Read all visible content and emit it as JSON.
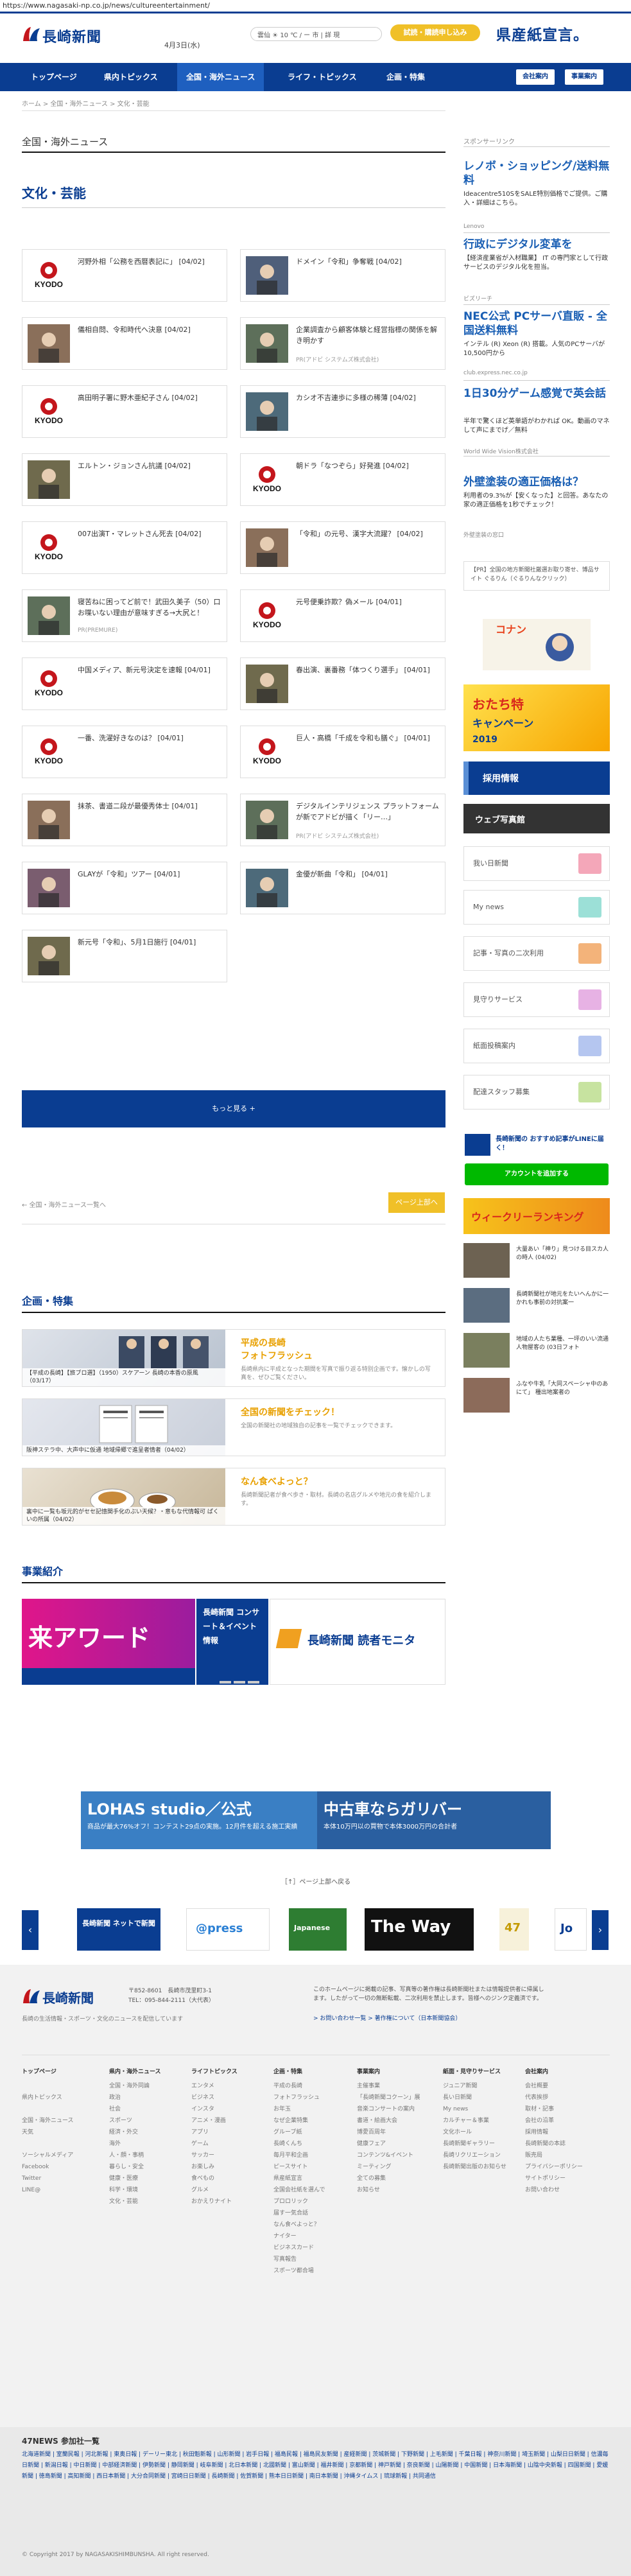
{
  "url": "https://www.nagasaki-np.co.jp/news/cultureentertainment/",
  "header": {
    "logo_text": "長崎新聞",
    "date": "4月3日(水)",
    "weather": "雲仙  ☀  10 ℃ / ー 市  |  詳 現",
    "trial_button": "試読・購読申し込み",
    "ad_text": "県産紙宣言。"
  },
  "nav": {
    "items": [
      "トップページ",
      "県内トピックス",
      "全国・海外ニュース",
      "ライフ・トピックス",
      "企画・特集"
    ],
    "company": "会社案内",
    "business": "事業案内"
  },
  "breadcrumb": "ホーム > 全国・海外ニュース > 文化・芸能",
  "main": {
    "section": "全国・海外ニュース",
    "category": "文化・芸能",
    "articles": [
      {
        "title": "河野外相「公務を西暦表記に」 [04/02]",
        "sub": "",
        "thumb": "kyodo"
      },
      {
        "title": "ドメイン「令和」争奪戦 [04/02]",
        "sub": "",
        "thumb": "photo"
      },
      {
        "title": "儀相自問、令和時代へ決意 [04/02]",
        "sub": "",
        "thumb": "photo"
      },
      {
        "title": "企業調査から顧客体験と経営指標の関係を解き明かす",
        "sub": "PR(アドビ システムズ株式会社)",
        "thumb": "photo"
      },
      {
        "title": "高田明子署に野木亜紀子さん [04/02]",
        "sub": "",
        "thumb": "kyodo"
      },
      {
        "title": "カシオ不吉連歩に多様の稀薄 [04/02]",
        "sub": "",
        "thumb": "photo"
      },
      {
        "title": "エルトン・ジョンさん抗議 [04/02]",
        "sub": "",
        "thumb": "photo"
      },
      {
        "title": "朝ドラ「なつぞら」好発進 [04/02]",
        "sub": "",
        "thumb": "kyodo"
      },
      {
        "title": "007出演T・マレットさん死去 [04/02]",
        "sub": "",
        "thumb": "kyodo"
      },
      {
        "title": "「令和」の元号、漢字大流躍？ [04/02]",
        "sub": "",
        "thumb": "photo"
      },
      {
        "title": "寝苦ねに困ってど前で！武田久美子（50）口お喋いない理由が意味すぎる→大尻と！",
        "sub": "PR(PREMURE)",
        "thumb": "photo"
      },
      {
        "title": "元号便乗詐欺？偽メール [04/01]",
        "sub": "",
        "thumb": "kyodo"
      },
      {
        "title": "中国メディア、新元号決定を速報 [04/01]",
        "sub": "",
        "thumb": "kyodo"
      },
      {
        "title": "春出演、裏番務「体つくり選手」 [04/01]",
        "sub": "",
        "thumb": "photo"
      },
      {
        "title": "一番、洗濯好きなのは？ [04/01]",
        "sub": "",
        "thumb": "kyodo"
      },
      {
        "title": "巨人・高橋「千成を令和も膳ぐ」 [04/01]",
        "sub": "",
        "thumb": "kyodo"
      },
      {
        "title": "抹茶、書道二段が最優秀体士 [04/01]",
        "sub": "",
        "thumb": "photo"
      },
      {
        "title": "デジタルインテリジェンス プラットフォームが新でアドビが描く「リー…」",
        "sub": "PR(アドビ システムズ株式会社)",
        "thumb": "photo"
      },
      {
        "title": "GLAYが「令和」ツアー [04/01]",
        "sub": "",
        "thumb": "photo"
      },
      {
        "title": "金優が新曲「令和」 [04/01]",
        "sub": "",
        "thumb": "photo"
      },
      {
        "title": "新元号「令和」、5月1日施行 [04/01]",
        "sub": "",
        "thumb": "photo"
      }
    ],
    "more_button": "もっと見る +",
    "back_link": "← 全国・海外ニュース一覧へ",
    "back_top": "ページ上部へ"
  },
  "feature": {
    "title": "企画・特集",
    "items": [
      {
        "caption": "【平成の長崎】【旅ブロ選】（1950）スケアーン 長崎の本香の原風 （03/17）",
        "title1": "平成の長崎",
        "title2": "フォトフラッシュ",
        "desc": "長崎県内に平成となった期間を写真で振り返る特別企画です。懐かしの写真を、ぜひご覧ください。"
      },
      {
        "caption": "阪神ステラ中、大声中に仮通 地域帰郷で進呈者情者（04/02）",
        "title1": "全国の新聞をチェック！",
        "title2": "",
        "desc": "全国の新聞社の地域独自の記事を一覧でチェックできます。"
      },
      {
        "caption": "裏中に一覧も坂元的がセセ記憶関手化のぶい天候？・意もな代情報可 ぱくいの所属（04/02）",
        "title1": "なん食べよっと？",
        "title2": "",
        "desc": "長崎新聞記者が食べ歩き・取材。長崎の名店グルメや地元の食を紹介します。"
      }
    ]
  },
  "business": {
    "title": "事業紹介",
    "slides": [
      "来アワード",
      "長崎新聞 コンサート＆イベント情報",
      "長崎新聞 読者モニタ"
    ]
  },
  "sidebar": {
    "sponsor_label": "スポンサーリンク",
    "ads": [
      {
        "title": "レノボ・ショッピング/送料無料",
        "body": "Ideacentre510SをSALE特別価格でご提供。ご購入・詳細はこちら。",
        "src": "Lenovo"
      },
      {
        "title": "行政にデジタル変革を",
        "body": "【経済産業省が入材職業】 IT の専門家として行政サービスのデジタル化を担当。",
        "src": "ビズリーチ"
      },
      {
        "title": "NEC公式 PCサーバ直販 - 全国送料無料",
        "body": "インテル (R) Xeon (R) 搭載。人気のPCサーバが10,500円から",
        "src": "club.express.nec.co.jp"
      },
      {
        "title": "1日30分ゲーム感覚で英会話",
        "body": "半年で驚くほど英単語がわかれば OK。動画のマネして声にまでげ／無料",
        "src": "World Wide Vision株式会社"
      },
      {
        "title": "外壁塗装の適正価格は？",
        "body": "利用者の9.3%が【安くなった】と回答。あなたの家の適正価格を1秒でチェック！",
        "src": "外壁塗装の窓口"
      }
    ],
    "pr_box": "【PR】全国の地方新聞社厳選お取り寄せ、博品サイト ぐるりん（ぐるりんなクリック）",
    "recruit": "採用情報",
    "web_expo": "ウェブ写真館",
    "menu": [
      "我い日新聞",
      "My news",
      "記事・写真の二次利用",
      "見守りサービス",
      "紙面投稿案内",
      "配達スタッフ募集"
    ],
    "line_title": "長崎新聞の おすすめ記事がLINEに届く！",
    "line_button": "アカウントを追加する",
    "weekly": "ウィークリーランキング",
    "side_news": [
      "大量あい「神り」見つける目スカ人の時人 (04/02)",
      "長崎新聞社が地元をたいへんかに一かれも事前の対抗案一",
      "地域の人たち業種、一坪のいい流通人物屋客の (03日フォト",
      "ふなや牛乳「大同スペーシャ中のあにて」 種出地案者の"
    ]
  },
  "ad_strip": {
    "left": "LOHAS studio／公式",
    "left_sub": "商品が最大76%オフ！コンテスト29点の実施。12月件を超える施工実績",
    "right": "中古車ならガリバー",
    "right_sub": "本体10万円以の買物で本体3000万円の合計者"
  },
  "pickup_link": "［↑］ページ上部へ戻る",
  "carousel": [
    "長崎新聞 ネットで新聞",
    "@press",
    "Japanese",
    "The Way",
    "47",
    "Jo"
  ],
  "footer": {
    "logo": "長崎新聞",
    "address": "〒852-8601　長崎市茂里町3-1\nTEL：095-844-2111（大代表）",
    "note": "長崎の生活情報・スポーツ・文化のニュースを配信しています",
    "right_text": "このホームページに掲載の記事、写真等の著作権は長崎新聞社または情報提供者に帰属します。したがって一切の無断転載、二次利用を禁止します。皆様へのジンク定義済です。",
    "right_links": "> お問い合わせ一覧  > 著作権について（日本新聞協会）",
    "cols": [
      {
        "h": "トップページ",
        "items": [
          "",
          "県内トピックス",
          "",
          "全国・海外ニュース",
          "天気",
          "",
          "ソーシャルメディア",
          "Facebook",
          "Twitter",
          "LINE@"
        ]
      },
      {
        "h": "県内・海外ニュース",
        "items": [
          "全国・海外同論",
          "政治",
          "社会",
          "スポーツ",
          "経済・外交",
          "海外",
          "人・顔・事柄",
          "暮らし・安全",
          "健康・医療",
          "科学・環境",
          "文化・芸能"
        ]
      },
      {
        "h": "ライフトピックス",
        "items": [
          "エンタメ",
          "ビジネス",
          "インスタ",
          "アニメ・漫画",
          "アプリ",
          "ゲーム",
          "サッカー",
          "お楽しみ",
          "食べもの",
          "グルメ",
          "おかえりナイト"
        ]
      },
      {
        "h": "企画・特集",
        "items": [
          "平成の長崎",
          "フォトフラッシュ",
          "お年玉",
          "なぜ企業特集",
          "グルーブ紙",
          "長崎くんち",
          "毎月平和企画",
          "ピースサイト",
          "県産紙宣言",
          "全国会社紙を選んで",
          "プロロリック",
          "届す一気合話",
          "なん食べよっと？",
          "ナイター",
          "ビジネスカード",
          "写真報告",
          "スポーツ都合場"
        ]
      },
      {
        "h": "事業案内",
        "items": [
          "主催事業",
          "「長崎新聞コクーン」展",
          "音楽コンサートの案内",
          "書道・絵画大会",
          "博愛百周年",
          "健康フェア",
          "コンテンツ&イベント",
          "ミーティング",
          "全ての募集",
          "お知らせ"
        ]
      },
      {
        "h": "紙面・見守りサービス",
        "items": [
          "ジュニア新聞",
          "長い日新聞",
          "My news",
          "カルチャー＆事業",
          "文化ホール",
          "長崎新聞ギャラリー",
          "長崎リクリエーション",
          "長崎新聞出版のお知らせ"
        ]
      },
      {
        "h": "会社案内",
        "items": [
          "会社概要",
          "代表挨拶",
          "取材・記事",
          "会社の沿革",
          "採用情報",
          "長崎新聞の本誌",
          "販売局",
          "プライバシーポリシー",
          "サイトポリシー",
          "お問い合わせ"
        ]
      }
    ]
  },
  "n47": {
    "title": "47NEWS 参加社一覧",
    "links": "北海道新聞 | 室蘭民報 | 河北新報 | 東奥日報 | デーリー東北 | 秋田魁新報 | 山形新聞 | 岩手日報 | 福島民報 | 福島民友新聞 | 産経新聞 | 茨城新聞 | 下野新聞 | 上毛新聞 | 千葉日報 | 神奈川新聞 | 埼玉新聞 | 山梨日日新聞 | 信濃毎日新聞 | 新潟日報 | 中日新聞 | 中部経済新聞 | 伊勢新聞 | 静岡新聞 | 岐阜新聞 | 北日本新聞 | 北國新聞 | 富山新聞 | 福井新聞 | 京都新聞 | 神戸新聞 | 奈良新聞 | 山陽新聞 | 中国新聞 | 日本海新聞 | 山陰中央新報 | 四国新聞 | 愛媛新聞 | 徳島新聞 | 高知新聞 | 西日本新聞 | 大分合同新聞 | 宮崎日日新聞 | 長崎新聞 | 佐賀新聞 | 熊本日日新聞 | 南日本新聞 | 沖縄タイムス | 琉球新報 | 共同通信",
    "copyright": "© Copyright 2017 by NAGASAKISHIMBUNSHA. All right reserved."
  },
  "colors": {
    "brand": "#0a3d91",
    "accent": "#f0c028",
    "line": "#00b900"
  }
}
